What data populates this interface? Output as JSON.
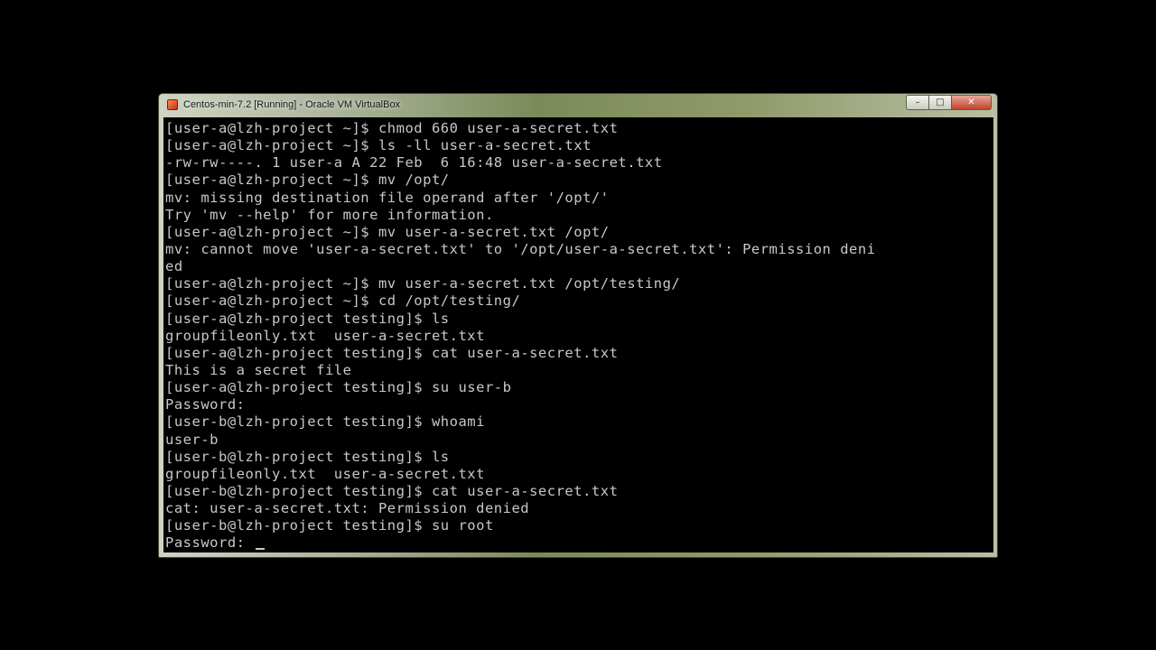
{
  "window": {
    "title": "Centos-min-7.2 [Running] - Oracle VM VirtualBox",
    "icon": "virtualbox-app-icon",
    "controls": {
      "minimize": "–",
      "maximize": "□",
      "close": "✕"
    }
  },
  "console": {
    "lines": [
      "[user-a@lzh-project ~]$ chmod 660 user-a-secret.txt",
      "[user-a@lzh-project ~]$ ls -ll user-a-secret.txt",
      "-rw-rw----. 1 user-a A 22 Feb  6 16:48 user-a-secret.txt",
      "[user-a@lzh-project ~]$ mv /opt/",
      "mv: missing destination file operand after '/opt/'",
      "Try 'mv --help' for more information.",
      "[user-a@lzh-project ~]$ mv user-a-secret.txt /opt/",
      "mv: cannot move 'user-a-secret.txt' to '/opt/user-a-secret.txt': Permission deni",
      "ed",
      "[user-a@lzh-project ~]$ mv user-a-secret.txt /opt/testing/",
      "[user-a@lzh-project ~]$ cd /opt/testing/",
      "[user-a@lzh-project testing]$ ls",
      "groupfileonly.txt  user-a-secret.txt",
      "[user-a@lzh-project testing]$ cat user-a-secret.txt",
      "This is a secret file",
      "[user-a@lzh-project testing]$ su user-b",
      "Password:",
      "[user-b@lzh-project testing]$ whoami",
      "user-b",
      "[user-b@lzh-project testing]$ ls",
      "groupfileonly.txt  user-a-secret.txt",
      "[user-b@lzh-project testing]$ cat user-a-secret.txt",
      "cat: user-a-secret.txt: Permission denied",
      "[user-b@lzh-project testing]$ su root"
    ],
    "prompt_line": "Password: "
  }
}
